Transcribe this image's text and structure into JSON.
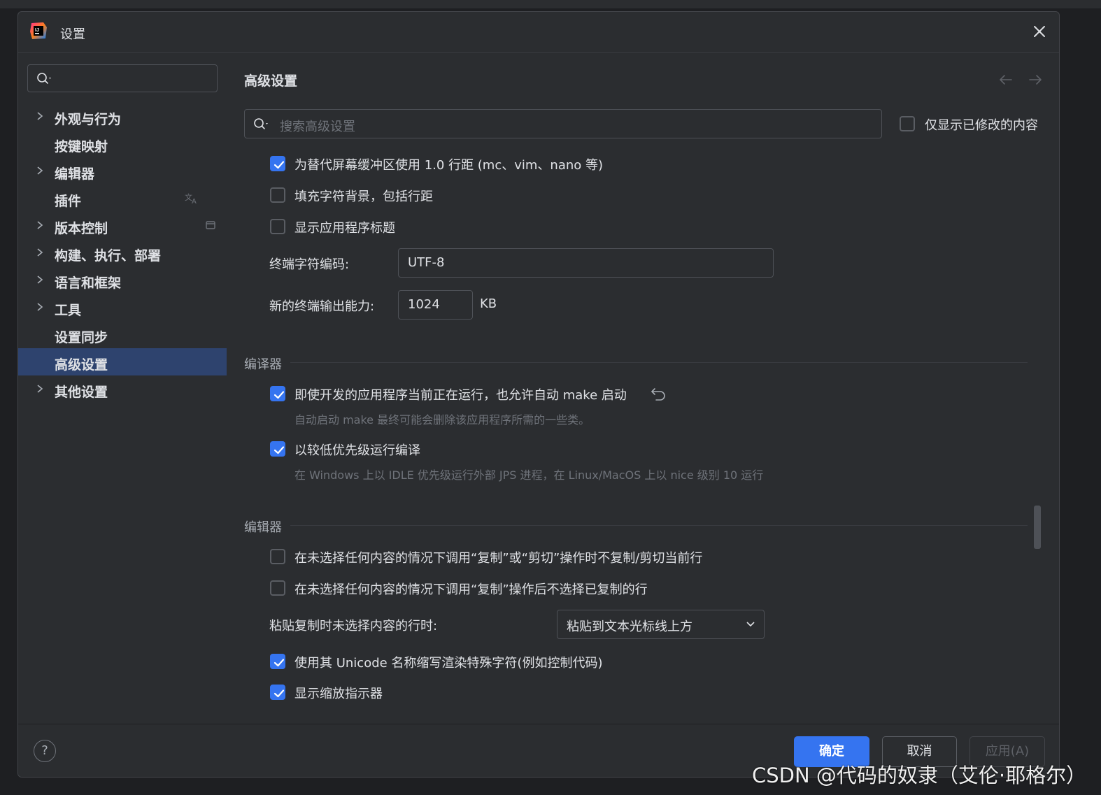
{
  "window": {
    "title": "设置"
  },
  "sidebar": {
    "search_placeholder": "",
    "items": [
      {
        "label": "外观与行为",
        "expandable": true
      },
      {
        "label": "按键映射",
        "expandable": false
      },
      {
        "label": "编辑器",
        "expandable": true
      },
      {
        "label": "插件",
        "expandable": false,
        "trailing_icon": "translate-icon"
      },
      {
        "label": "版本控制",
        "expandable": true,
        "trailing_icon": "window-icon"
      },
      {
        "label": "构建、执行、部署",
        "expandable": true
      },
      {
        "label": "语言和框架",
        "expandable": true
      },
      {
        "label": "工具",
        "expandable": true
      },
      {
        "label": "设置同步",
        "expandable": false
      },
      {
        "label": "高级设置",
        "expandable": false,
        "selected": true
      },
      {
        "label": "其他设置",
        "expandable": true
      }
    ]
  },
  "main": {
    "title": "高级设置",
    "search_placeholder": "搜索高级设置",
    "only_modified_label": "仅显示已修改的内容",
    "only_modified_checked": false,
    "terminal": {
      "opt1": {
        "label": "为替代屏幕缓冲区使用 1.0 行距 (mc、vim、nano 等)",
        "checked": true
      },
      "opt2": {
        "label": "填充字符背景，包括行距",
        "checked": false
      },
      "opt3": {
        "label": "显示应用程序标题",
        "checked": false
      },
      "encoding_label": "终端字符编码:",
      "encoding_value": "UTF-8",
      "output_label": "新的终端输出能力:",
      "output_value": "1024",
      "output_unit": "KB"
    },
    "compiler": {
      "heading": "编译器",
      "opt1": {
        "label": "即使开发的应用程序当前正在运行，也允许自动 make 启动",
        "checked": true,
        "hint": "自动启动 make 最终可能会删除该应用程序所需的一些类。"
      },
      "opt2": {
        "label": "以较低优先级运行编译",
        "checked": true,
        "hint": "在 Windows 上以 IDLE 优先级运行外部 JPS 进程，在 Linux/MacOS 上以 nice 级别 10 运行"
      }
    },
    "editor": {
      "heading": "编辑器",
      "opt1": {
        "label": "在未选择任何内容的情况下调用“复制”或“剪切”操作时不复制/剪切当前行",
        "checked": false
      },
      "opt2": {
        "label": "在未选择任何内容的情况下调用“复制”操作后不选择已复制的行",
        "checked": false
      },
      "paste_label": "粘贴复制时未选择内容的行时:",
      "paste_value": "粘贴到文本光标线上方",
      "opt3": {
        "label": "使用其 Unicode 名称缩写渲染特殊字符(例如控制代码)",
        "checked": true
      },
      "opt4": {
        "label": "显示缩放指示器",
        "checked": true
      }
    }
  },
  "footer": {
    "help": "?",
    "ok": "确定",
    "cancel": "取消",
    "apply": "应用(A)"
  },
  "watermark": "CSDN @代码的奴隶（艾伦·耶格尔）",
  "colors": {
    "accent": "#3574f0",
    "background": "#2b2d30",
    "selection": "#2e436e"
  }
}
